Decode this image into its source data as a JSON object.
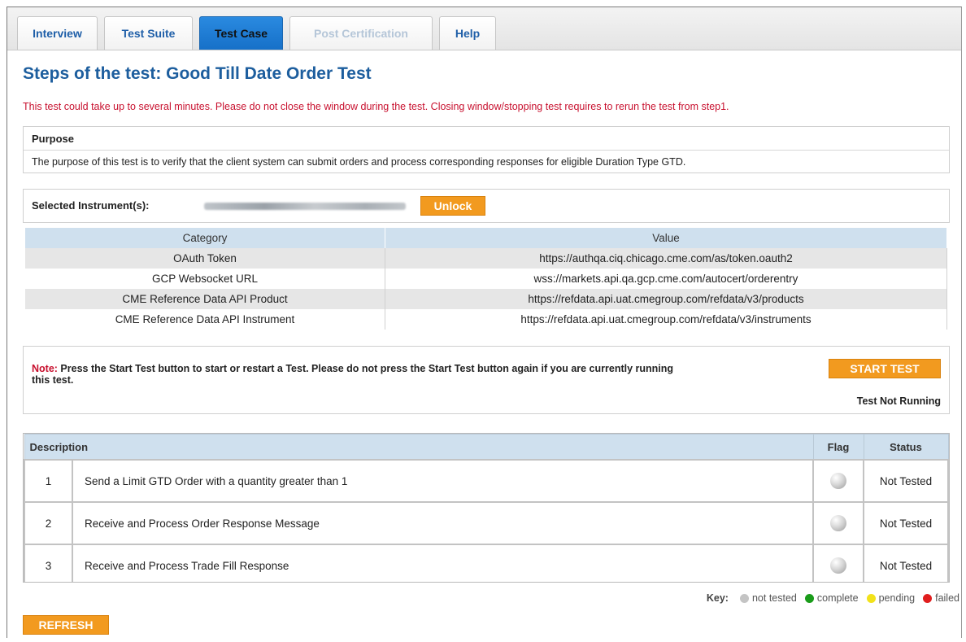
{
  "tabs": [
    {
      "label": "Interview",
      "state": "normal"
    },
    {
      "label": "Test Suite",
      "state": "normal"
    },
    {
      "label": "Test Case",
      "state": "active"
    },
    {
      "label": "Post Certification",
      "state": "disabled"
    },
    {
      "label": "Help",
      "state": "normal"
    }
  ],
  "page_title": "Steps of the test: Good Till Date Order Test",
  "warning": "This test could take up to several minutes. Please do not close the window during the test. Closing window/stopping test requires to rerun the test from step1.",
  "purpose": {
    "heading": "Purpose",
    "text": "The purpose of this test is to verify that the client system can submit orders and process corresponding responses for eligible Duration Type GTD."
  },
  "instrument": {
    "label": "Selected Instrument(s):",
    "unlock_label": "Unlock"
  },
  "config_table": {
    "headers": [
      "Category",
      "Value"
    ],
    "rows": [
      {
        "category": "OAuth Token",
        "value": "https://authqa.ciq.chicago.cme.com/as/token.oauth2"
      },
      {
        "category": "GCP Websocket URL",
        "value": "wss://markets.api.qa.gcp.cme.com/autocert/orderentry"
      },
      {
        "category": "CME Reference Data API Product",
        "value": "https://refdata.api.uat.cmegroup.com/refdata/v3/products"
      },
      {
        "category": "CME Reference Data API Instrument",
        "value": "https://refdata.api.uat.cmegroup.com/refdata/v3/instruments"
      }
    ]
  },
  "note": {
    "prefix": "Note:",
    "text": " Press the Start Test button to start or restart a Test. Please do not press the Start Test button again if you are currently running this test.",
    "start_label": "START TEST",
    "test_state": "Test Not Running"
  },
  "steps": {
    "headers": {
      "description": "Description",
      "flag": "Flag",
      "status": "Status"
    },
    "rows": [
      {
        "num": "1",
        "desc": "Send a Limit GTD Order with a quantity greater than 1",
        "status": "Not Tested"
      },
      {
        "num": "2",
        "desc": "Receive and Process Order Response Message",
        "status": "Not Tested"
      },
      {
        "num": "3",
        "desc": "Receive and Process Trade Fill Response",
        "status": "Not Tested"
      }
    ]
  },
  "key": {
    "label": "Key:",
    "items": [
      {
        "label": "not tested",
        "color": "#c4c4c4"
      },
      {
        "label": "complete",
        "color": "#1a9c1a"
      },
      {
        "label": "pending",
        "color": "#f2e21a"
      },
      {
        "label": "failed",
        "color": "#e01e1e"
      }
    ]
  },
  "refresh_label": "REFRESH",
  "colors": {
    "accent": "#f29a1f",
    "title": "#1d5e9e",
    "warning": "#c8102e",
    "active_tab": "#1670c8"
  }
}
